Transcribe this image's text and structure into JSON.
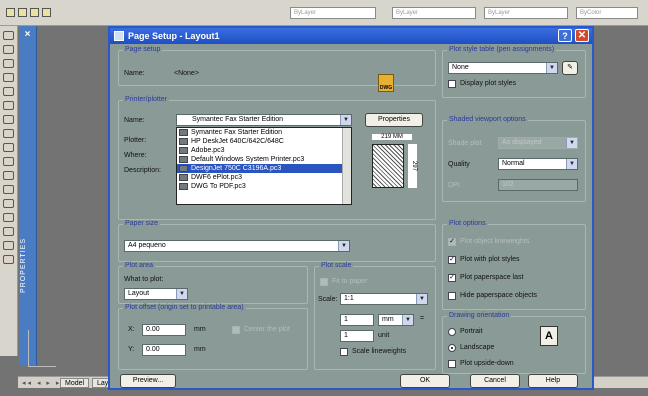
{
  "dialog": {
    "title": "Page Setup - Layout1",
    "help": "?",
    "close": "✕"
  },
  "page_setup": {
    "group_title": "Page setup",
    "name_label": "Name:",
    "name_value": "<None>",
    "icon": "DWG"
  },
  "printer": {
    "group_title": "Printer/plotter",
    "name_label": "Name:",
    "selected": "Symantec Fax Starter Edition",
    "properties_button": "Properties",
    "plotter_label": "Plotter:",
    "where_label": "Where:",
    "description_label": "Description:",
    "options": [
      "Symantec Fax Starter Edition",
      "HP DeskJet 640C/642C/648C",
      "Adobe.pc3",
      "Default Windows System Printer.pc3",
      "DesignJet 750C C3196A.pc3",
      "DWF6 ePlot.pc3",
      "DWG To PDF.pc3"
    ],
    "highlighted_index": 4,
    "preview_width": "219 MM",
    "preview_height": "297"
  },
  "paper_size": {
    "group_title": "Paper size",
    "value": "A4 pequeno"
  },
  "plot_area": {
    "group_title": "Plot area",
    "what_label": "What to plot:",
    "value": "Layout"
  },
  "plot_offset": {
    "group_title": "Plot offset (origin set to printable area)",
    "x_label": "X:",
    "x_value": "0.00",
    "y_label": "Y:",
    "y_value": "0.00",
    "unit": "mm",
    "center_label": "Center the plot"
  },
  "plot_scale": {
    "group_title": "Plot scale",
    "fit_label": "Fit to paper",
    "scale_label": "Scale:",
    "scale_value": "1:1",
    "num_value": "1",
    "unit_select": "mm",
    "equals": "=",
    "unit_value": "1",
    "unit_text": "unit",
    "lineweights_label": "Scale lineweights"
  },
  "plot_style": {
    "group_title": "Plot style table (pen assignments)",
    "value": "None",
    "display_label": "Display plot styles"
  },
  "shaded": {
    "group_title": "Shaded viewport options",
    "shade_label": "Shade plot",
    "shade_value": "As displayed",
    "quality_label": "Quality",
    "quality_value": "Normal",
    "dpi_label": "DPI",
    "dpi_value": "102"
  },
  "plot_options": {
    "group_title": "Plot options",
    "items": [
      {
        "label": "Plot object lineweights",
        "checked": true,
        "disabled": true
      },
      {
        "label": "Plot with plot styles",
        "checked": true,
        "disabled": false
      },
      {
        "label": "Plot paperspace last",
        "checked": true,
        "disabled": false
      },
      {
        "label": "Hide paperspace objects",
        "checked": false,
        "disabled": false
      }
    ]
  },
  "orientation": {
    "group_title": "Drawing orientation",
    "portrait": "Portrait",
    "landscape": "Landscape",
    "upside_down": "Plot upside-down",
    "selected": "Landscape"
  },
  "buttons": {
    "preview": "Preview...",
    "ok": "OK",
    "cancel": "Cancel",
    "help": "Help"
  },
  "toolbar": {
    "layer": "ByLayer",
    "linetype": "ByLayer",
    "lineweight": "ByLayer",
    "color": "ByColor"
  },
  "side": {
    "properties": "PROPERTIES"
  },
  "tabs": {
    "model": "Model",
    "layout": "Lay"
  }
}
